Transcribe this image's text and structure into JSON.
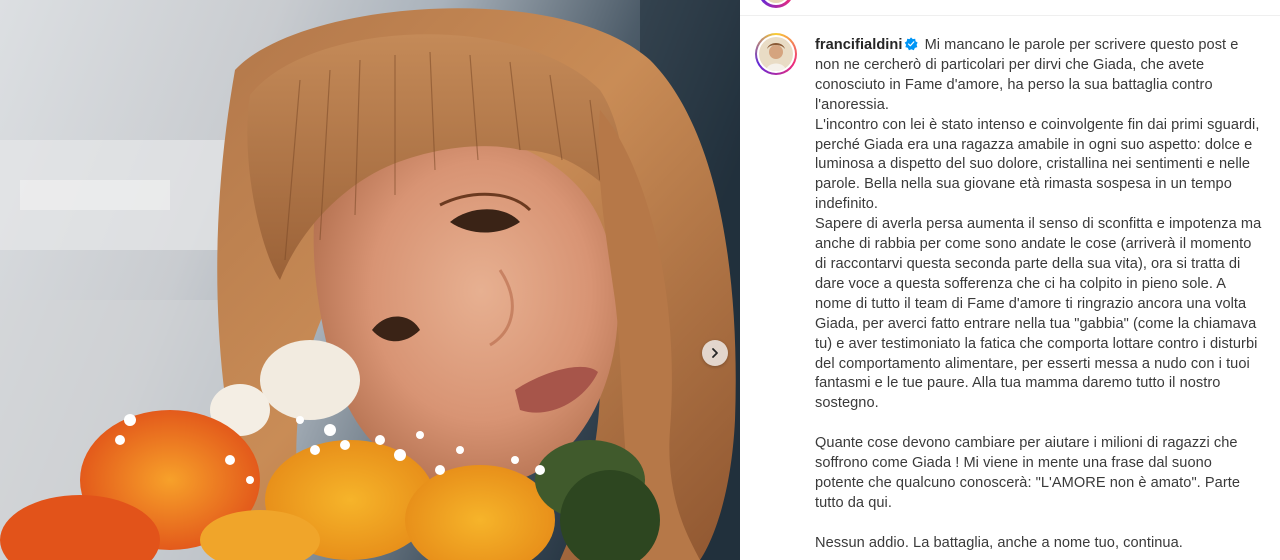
{
  "post": {
    "username": "francifialdini",
    "verified": true,
    "caption_paragraphs": [
      "Mi mancano le parole per scrivere questo post e non ne cercherò di particolari per dirvi che Giada, che avete conosciuto in Fame d'amore, ha perso la sua battaglia contro l'anoressia.",
      "L'incontro con lei è stato intenso e coinvolgente fin dai primi sguardi, perché Giada era una ragazza amabile in ogni suo aspetto: dolce e luminosa a dispetto del suo dolore, cristallina nei sentimenti e nelle parole. Bella nella sua giovane età rimasta sospesa in un tempo indefinito.",
      "Sapere di averla persa aumenta il senso di sconfitta e impotenza ma anche di rabbia per come sono andate le cose (arriverà il momento di raccontarvi questa seconda parte della sua vita), ora si tratta di dare voce a questa sofferenza che ci ha colpito in pieno sole. A nome di tutto il team di Fame d'amore ti ringrazio ancora una volta Giada, per averci fatto entrare nella tua \"gabbia\" (come la chiamava tu) e aver testimoniato la fatica che comporta lottare contro i disturbi del comportamento alimentare, per esserti messa a nudo con i tuoi fantasmi e le tue paure. Alla tua mamma daremo tutto il nostro sostegno.",
      "",
      "Quante cose devono cambiare per aiutare i milioni di ragazzi che soffrono come Giada ! Mi viene in mente una frase dal suono potente che qualcuno conoscerà: \"L'AMORE non è amato\". Parte tutto da qui.",
      "",
      "Nessun addio. La battaglia, anche a nome tuo, continua."
    ]
  },
  "media": {
    "photo_subject": "portrait-with-flower-bouquet",
    "next_icon": "chevron-right-icon"
  },
  "colors": {
    "verified_blue": "#0095f6",
    "text": "#3a3a3a",
    "username": "#262626",
    "story_ring": [
      "#f9ce34",
      "#ee2a7b",
      "#6228d7"
    ]
  }
}
